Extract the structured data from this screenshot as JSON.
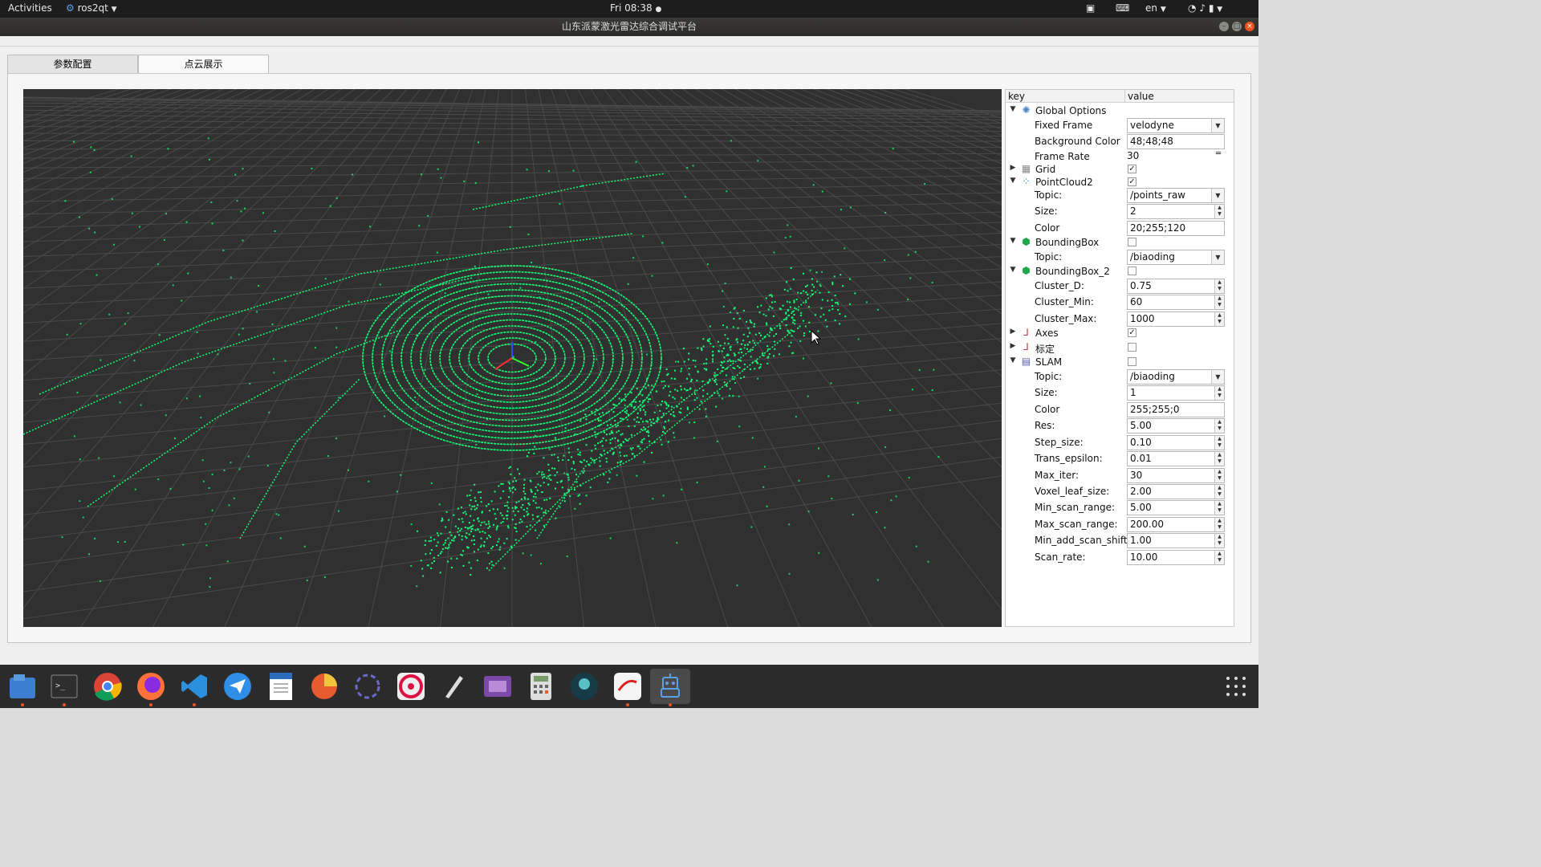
{
  "topbar": {
    "activities": "Activities",
    "app_menu": "ros2qt",
    "clock": "Fri 08:38",
    "lang": "en"
  },
  "window": {
    "title": "山东派蒙激光雷达综合调试平台"
  },
  "tabs": [
    {
      "label": "参数配置",
      "active": false
    },
    {
      "label": "点云展示",
      "active": true
    }
  ],
  "viewer": {
    "background_color": "#303030",
    "point_color": "#14ff78"
  },
  "props": {
    "header_key": "key",
    "header_value": "value",
    "global_options": {
      "label": "Global Options",
      "fixed_frame_key": "Fixed Frame",
      "fixed_frame_value": "velodyne",
      "background_color_key": "Background Color",
      "background_color_value": "48;48;48",
      "frame_rate_key": "Frame Rate",
      "frame_rate_value": "30"
    },
    "grid": {
      "label": "Grid",
      "checked": true
    },
    "pointcloud2": {
      "label": "PointCloud2",
      "checked": true,
      "topic_key": "Topic:",
      "topic_value": "/points_raw",
      "size_key": "Size:",
      "size_value": "2",
      "color_key": "Color",
      "color_value": "20;255;120"
    },
    "boundingbox": {
      "label": "BoundingBox",
      "checked": false,
      "topic_key": "Topic:",
      "topic_value": "/biaoding"
    },
    "boundingbox2": {
      "label": "BoundingBox_2",
      "checked": false,
      "cluster_d_key": "Cluster_D:",
      "cluster_d_value": "0.75",
      "cluster_min_key": "Cluster_Min:",
      "cluster_min_value": "60",
      "cluster_max_key": "Cluster_Max:",
      "cluster_max_value": "1000"
    },
    "axes": {
      "label": "Axes",
      "checked": true
    },
    "biaoding": {
      "label": "标定",
      "checked": false
    },
    "slam": {
      "label": "SLAM",
      "checked": false,
      "topic_key": "Topic:",
      "topic_value": "/biaoding",
      "size_key": "Size:",
      "size_value": "1",
      "color_key": "Color",
      "color_value": "255;255;0",
      "res_key": "Res:",
      "res_value": "5.00",
      "step_size_key": "Step_size:",
      "step_size_value": "0.10",
      "trans_epsilon_key": "Trans_epsilon:",
      "trans_epsilon_value": "0.01",
      "max_iter_key": "Max_iter:",
      "max_iter_value": "30",
      "voxel_leaf_size_key": "Voxel_leaf_size:",
      "voxel_leaf_size_value": "2.00",
      "min_scan_range_key": "Min_scan_range:",
      "min_scan_range_value": "5.00",
      "max_scan_range_key": "Max_scan_range:",
      "max_scan_range_value": "200.00",
      "min_add_scan_shift_key": "Min_add_scan_shift:",
      "min_add_scan_shift_value": "1.00",
      "scan_rate_key": "Scan_rate:",
      "scan_rate_value": "10.00"
    }
  },
  "dock": {
    "apps": [
      "files-icon",
      "terminal-icon",
      "chrome-icon",
      "firefox-icon",
      "vscode-icon",
      "feishu-icon",
      "writer-icon",
      "disk-usage-icon",
      "network-icon",
      "optical-drive-icon",
      "text-editor-icon",
      "video-editor-icon",
      "calculator-icon",
      "gitkraken-icon",
      "wps-icon",
      "ros2qt-robot-icon"
    ]
  }
}
